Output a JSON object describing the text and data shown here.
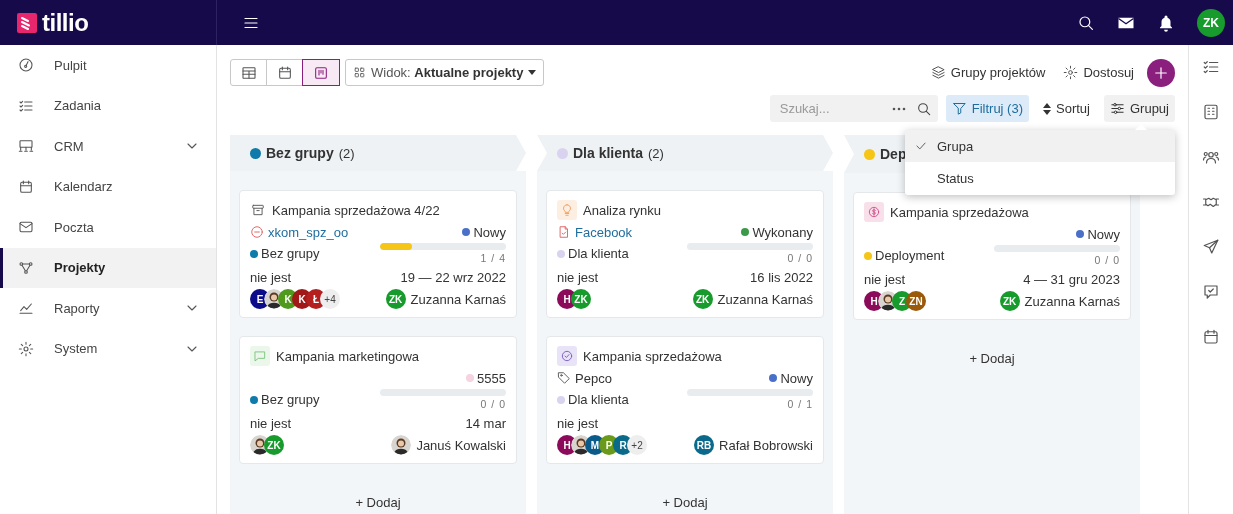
{
  "app": {
    "logo": "tillio",
    "user_initials": "ZK"
  },
  "sidebar": {
    "items": [
      {
        "label": "Pulpit",
        "selected": false,
        "expandable": false
      },
      {
        "label": "Zadania",
        "selected": false,
        "expandable": false
      },
      {
        "label": "CRM",
        "selected": false,
        "expandable": true
      },
      {
        "label": "Kalendarz",
        "selected": false,
        "expandable": false
      },
      {
        "label": "Poczta",
        "selected": false,
        "expandable": false
      },
      {
        "label": "Projekty",
        "selected": true,
        "expandable": false
      },
      {
        "label": "Raporty",
        "selected": false,
        "expandable": true
      },
      {
        "label": "System",
        "selected": false,
        "expandable": true
      }
    ]
  },
  "toolbar": {
    "views": [
      {
        "selected": false
      },
      {
        "selected": false
      },
      {
        "selected": true
      }
    ],
    "view_select": "Widok: **Aktualne projekty**",
    "actions": [
      "Grupy projektów",
      "Dostosuj"
    ],
    "search": {
      "placeholder": "Szukaj..."
    },
    "filter": {
      "label": "Filtruj (3)",
      "active": true
    },
    "sort": {
      "label": "Sortuj"
    },
    "group": {
      "label": "Grupuj",
      "open": true
    }
  },
  "group_menu": [
    {
      "label": "Grupa",
      "selected": true
    },
    {
      "label": "Status",
      "selected": false
    }
  ],
  "board": {
    "columns": [
      {
        "name": "Bez grupy",
        "count": "(2)",
        "color": "#0f7bab",
        "add_label": "+ Dodaj",
        "cards": [
          {
            "title": "Kampania sprzedażowa 4/22",
            "tag": {
              "label": "xkom_spz_oo",
              "link": true
            },
            "status": {
              "label": "Nowy",
              "color": "#4a6fc9"
            },
            "group": {
              "label": "Bez grupy",
              "color": "#0f7bab"
            },
            "progress": {
              "level": 0.25,
              "label": "1 / 4"
            },
            "assignee": "nie jest",
            "date": "19 — 22 wrz 2022",
            "avatars": [
              {
                "kind": "initials",
                "initials": "E",
                "color": "#0c0c8a"
              },
              {
                "kind": "photo"
              },
              {
                "kind": "initials",
                "initials": "K",
                "color": "#4f9a1c"
              },
              {
                "kind": "initials",
                "initials": "K",
                "color": "#a01818"
              },
              {
                "kind": "initials",
                "initials": "Ł",
                "color": "#b42020"
              },
              {
                "kind": "more",
                "label": "+4"
              }
            ],
            "owner": {
              "kind": "initials",
              "name": "Zuzanna Karnaś",
              "initials": "ZK",
              "color": "#179b2c"
            }
          },
          {
            "title": "Kampania marketingowa",
            "status": {
              "label": "5555",
              "color": "#f5d3e0"
            },
            "group": {
              "label": "Bez grupy",
              "color": "#0f7bab"
            },
            "progress": {
              "level": 0,
              "label": "0 / 0"
            },
            "assignee": "nie jest",
            "date": "14 mar",
            "avatars": [
              {
                "kind": "photo"
              },
              {
                "kind": "initials",
                "initials": "ZK",
                "color": "#179b2c"
              }
            ],
            "owner": {
              "kind": "photo",
              "name": "Januś Kowalski"
            }
          }
        ]
      },
      {
        "name": "Dla klienta",
        "count": "(2)",
        "color": "#d9d3f0",
        "add_label": "+ Dodaj",
        "cards": [
          {
            "title": "Analiza rynku",
            "tag": {
              "label": "Facebook",
              "link": true
            },
            "status": {
              "label": "Wykonany",
              "color": "#3a9a4a"
            },
            "group": {
              "label": "Dla klienta",
              "color": "#d9d3f0"
            },
            "progress": {
              "level": 0,
              "label": "0 / 0"
            },
            "assignee": "nie jest",
            "date": "16 lis 2022",
            "avatars": [
              {
                "kind": "initials",
                "initials": "H",
                "color": "#8b0a5a"
              },
              {
                "kind": "initials",
                "initials": "ZK",
                "color": "#179b2c"
              }
            ],
            "owner": {
              "kind": "initials",
              "name": "Zuzanna Karnaś",
              "initials": "ZK",
              "color": "#179b2c"
            }
          },
          {
            "title": "Kampania sprzedażowa",
            "tag": {
              "label": "Pepco",
              "link": false
            },
            "status": {
              "label": "Nowy",
              "color": "#4a6fc9"
            },
            "group": {
              "label": "Dla klienta",
              "color": "#d9d3f0"
            },
            "progress": {
              "level": 0,
              "label": "0 / 1"
            },
            "assignee": "nie jest",
            "avatars": [
              {
                "kind": "initials",
                "initials": "H",
                "color": "#8b0a5a"
              },
              {
                "kind": "photo"
              },
              {
                "kind": "initials",
                "initials": "M",
                "color": "#0a5a8a"
              },
              {
                "kind": "initials",
                "initials": "P",
                "color": "#6a9a1a"
              },
              {
                "kind": "initials",
                "initials": "R",
                "color": "#0a6a8a"
              },
              {
                "kind": "more",
                "label": "+2"
              }
            ],
            "owner": {
              "kind": "initials",
              "name": "Rafał Bobrowski",
              "initials": "RB",
              "color": "#0b6a8c"
            }
          }
        ]
      },
      {
        "name": "Dep",
        "color": "#f5c518",
        "add_label": "+ Dodaj",
        "cards": [
          {
            "title": "Kampania sprzedażowa",
            "status": {
              "label": "Nowy",
              "color": "#4a6fc9"
            },
            "group": {
              "label": "Deployment",
              "color": "#f5c518"
            },
            "progress": {
              "level": 0,
              "label": "0 / 0"
            },
            "assignee": "nie jest",
            "date": "4 — 31 gru 2023",
            "avatars": [
              {
                "kind": "initials",
                "initials": "H",
                "color": "#8b0a5a"
              },
              {
                "kind": "photo"
              },
              {
                "kind": "initials",
                "initials": "Z",
                "color": "#179b2c"
              },
              {
                "kind": "initials",
                "initials": "ZN",
                "color": "#9a5a0a"
              }
            ],
            "owner": {
              "kind": "initials",
              "name": "Zuzanna Karnaś",
              "initials": "ZK",
              "color": "#179b2c"
            }
          }
        ]
      }
    ]
  }
}
